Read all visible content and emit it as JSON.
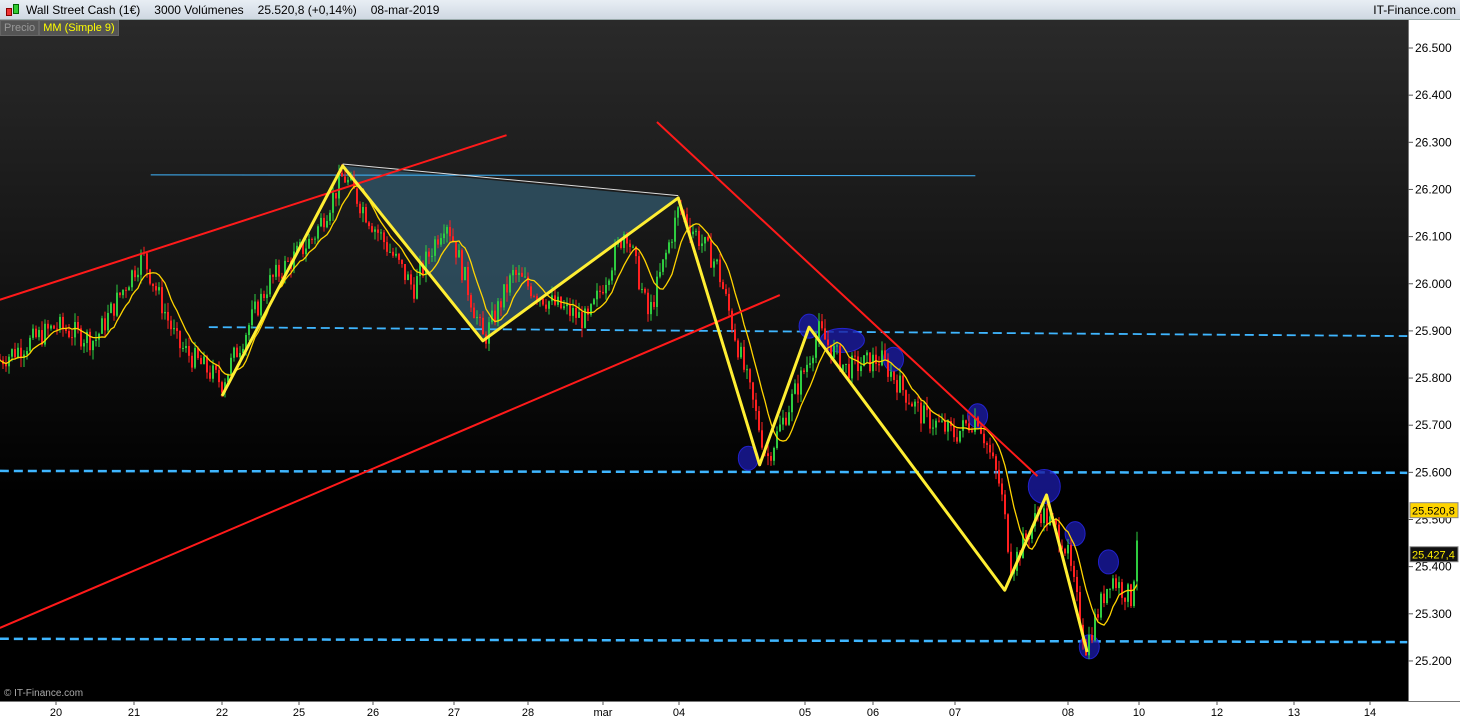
{
  "header": {
    "title": "Wall Street Cash (1€)",
    "volume": "3000 Volúmenes",
    "last": "25.520,8 (+0,14%)",
    "date": "08-mar-2019",
    "brand": "IT-Finance.com"
  },
  "tabs": {
    "price": "Precio",
    "ma": "MM (Simple 9)"
  },
  "copyright": "© IT-Finance.com",
  "colors": {
    "up": "#2ecc40",
    "down": "#ff2020",
    "ma": "#ffd400",
    "zigzag": "#ffee33",
    "trend": "#ff1a1a",
    "support": "#3fb6ff",
    "marker": "#1a1aa0",
    "fill": "#2f4f5f"
  },
  "chart_data": {
    "type": "candlestick",
    "ylim": [
      25150,
      26550
    ],
    "y_ticks": [
      "26.500",
      "26.400",
      "26.300",
      "26.200",
      "26.100",
      "26.000",
      "25.900",
      "25.800",
      "25.700",
      "25.600",
      "25.500",
      "25.400",
      "25.300",
      "25.200"
    ],
    "x_ticks": [
      "20",
      "21",
      "22",
      "25",
      "26",
      "27",
      "28",
      "mar",
      "04",
      "05",
      "06",
      "07",
      "08",
      "10",
      "12",
      "13",
      "14"
    ],
    "last_price_label": "25.520,8",
    "ma_label": "25.427,4",
    "price_path": [
      [
        -0.7,
        25840
      ],
      [
        0,
        25910
      ],
      [
        0.5,
        25880
      ],
      [
        1.1,
        26060
      ],
      [
        1.5,
        25870
      ],
      [
        2.0,
        25790
      ],
      [
        2.6,
        26000
      ],
      [
        3.2,
        26100
      ],
      [
        3.6,
        26230
      ],
      [
        4.1,
        26100
      ],
      [
        4.5,
        25990
      ],
      [
        4.9,
        26140
      ],
      [
        5.4,
        25880
      ],
      [
        5.8,
        26020
      ],
      [
        6.3,
        25960
      ],
      [
        6.8,
        25920
      ],
      [
        7.3,
        26120
      ],
      [
        7.6,
        25930
      ],
      [
        8.0,
        26160
      ],
      [
        8.3,
        26040
      ],
      [
        8.7,
        25630
      ],
      [
        9.0,
        25820
      ],
      [
        9.2,
        25900
      ],
      [
        9.6,
        25820
      ],
      [
        10.1,
        25840
      ],
      [
        10.6,
        25720
      ],
      [
        11.0,
        25680
      ],
      [
        11.2,
        25720
      ],
      [
        11.4,
        25570
      ],
      [
        11.5,
        25400
      ],
      [
        11.75,
        25520
      ],
      [
        11.95,
        25460
      ],
      [
        12.25,
        25230
      ],
      [
        12.6,
        25380
      ],
      [
        12.9,
        25330
      ],
      [
        13.0,
        25520
      ]
    ],
    "zigzag": [
      [
        2.0,
        25762
      ],
      [
        3.59,
        26250
      ],
      [
        5.39,
        25879
      ],
      [
        7.99,
        26182
      ],
      [
        8.64,
        25616
      ],
      [
        9.06,
        25908
      ],
      [
        11.44,
        25350
      ],
      [
        11.81,
        25552
      ],
      [
        12.27,
        25219
      ]
    ],
    "shaded_triangle": [
      [
        3.59,
        26250
      ],
      [
        7.99,
        26182
      ],
      [
        5.39,
        25879
      ]
    ],
    "resistance_line": [
      [
        1.19,
        26231
      ],
      [
        11.18,
        26229
      ]
    ],
    "white_line": [
      [
        3.59,
        26254
      ],
      [
        7.99,
        26187
      ]
    ],
    "trend_lines": [
      [
        [
          -0.72,
          25966
        ],
        [
          5.71,
          26315
        ]
      ],
      [
        [
          -0.72,
          25270
        ],
        [
          8.8,
          25976
        ]
      ],
      [
        [
          7.71,
          26343
        ],
        [
          11.73,
          25592
        ]
      ]
    ],
    "dashed_lines": [
      [
        [
          1.85,
          25908
        ],
        [
          16.49,
          25889
        ]
      ],
      [
        [
          -0.72,
          25603
        ],
        [
          16.49,
          25599
        ]
      ],
      [
        [
          -0.72,
          25247
        ],
        [
          16.49,
          25240
        ]
      ]
    ],
    "markers": [
      [
        8.55,
        25630
      ],
      [
        9.06,
        25910
      ],
      [
        9.55,
        25880
      ],
      [
        10.25,
        25840
      ],
      [
        11.2,
        25720
      ],
      [
        11.79,
        25570
      ],
      [
        12.1,
        25470
      ],
      [
        12.57,
        25410
      ],
      [
        12.3,
        25230
      ]
    ]
  }
}
